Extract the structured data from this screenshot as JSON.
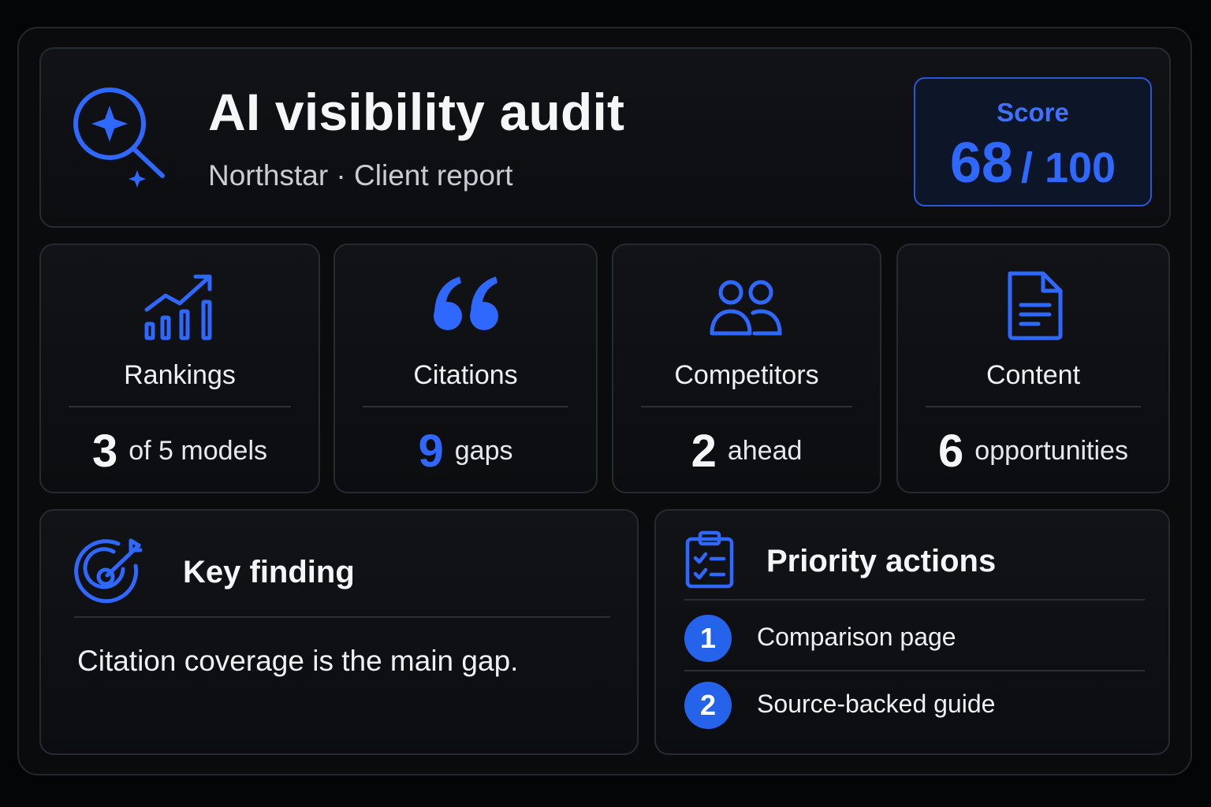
{
  "header": {
    "title": "AI visibility audit",
    "subtitle": "Northstar · Client report",
    "icon": "search-sparkle-icon",
    "score": {
      "label": "Score",
      "value": "68",
      "max": "/ 100"
    }
  },
  "metrics": [
    {
      "label": "Rankings",
      "value": "3",
      "unit": "of 5 models",
      "icon": "ranking-chart-icon",
      "value_color": "#f5f6f8"
    },
    {
      "label": "Citations",
      "value": "9",
      "unit": "gaps",
      "icon": "quote-icon",
      "value_color": "#2f68ff"
    },
    {
      "label": "Competitors",
      "value": "2",
      "unit": "ahead",
      "icon": "users-icon",
      "value_color": "#f5f6f8"
    },
    {
      "label": "Content",
      "value": "6",
      "unit": "opportunities",
      "icon": "document-icon",
      "value_color": "#f5f6f8"
    }
  ],
  "key_finding": {
    "title": "Key finding",
    "icon": "target-icon",
    "text": "Citation coverage is the main gap."
  },
  "priority_actions": {
    "title": "Priority actions",
    "icon": "clipboard-checklist-icon",
    "items": [
      {
        "number": "1",
        "label": "Comparison page"
      },
      {
        "number": "2",
        "label": "Source-backed guide"
      }
    ]
  },
  "colors": {
    "accent": "#2f68ff",
    "background": "#040506",
    "card": "#0f1114"
  }
}
